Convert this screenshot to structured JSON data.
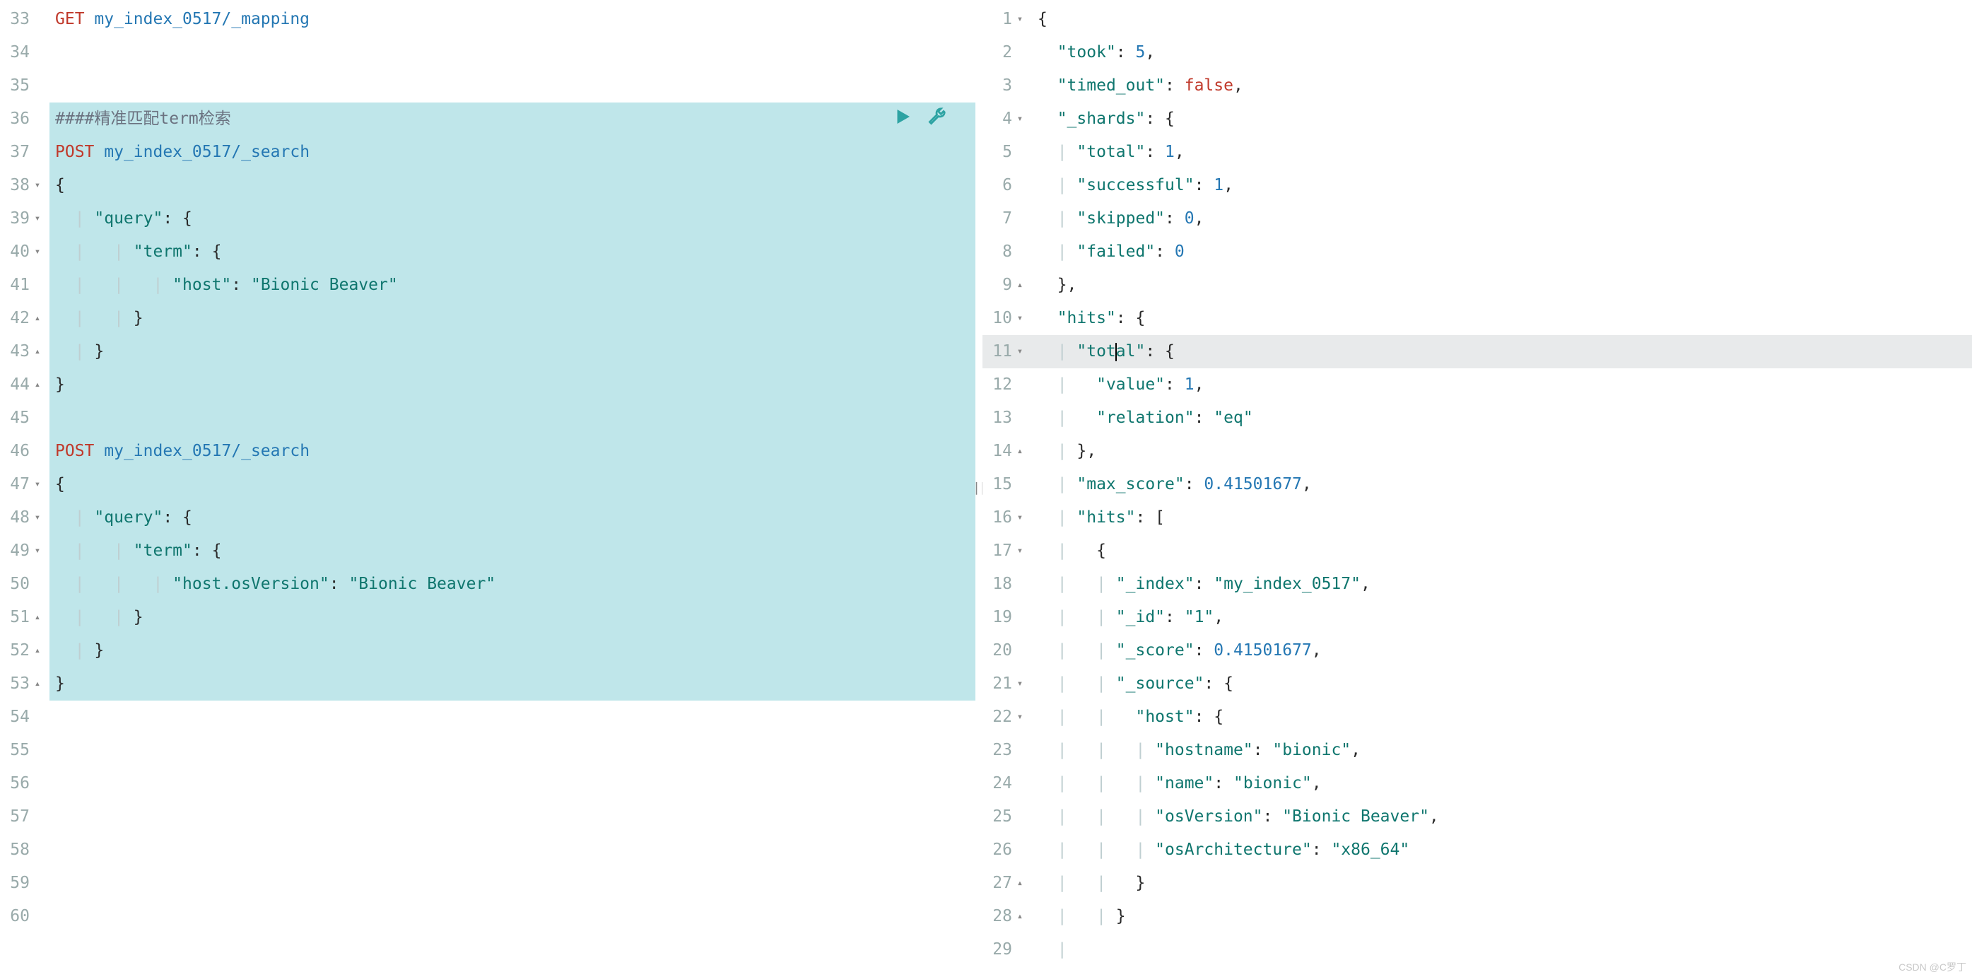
{
  "left": {
    "startLine": 33,
    "lines": [
      {
        "n": 33,
        "fold": "",
        "sel": false,
        "segs": [
          {
            "cls": "tok-method-get",
            "t": "GET "
          },
          {
            "cls": "tok-path",
            "t": "my_index_0517/_mapping"
          }
        ]
      },
      {
        "n": 34,
        "fold": "",
        "sel": false,
        "segs": []
      },
      {
        "n": 35,
        "fold": "",
        "sel": false,
        "segs": []
      },
      {
        "n": 36,
        "fold": "",
        "sel": true,
        "runIcons": true,
        "segs": [
          {
            "cls": "tok-comment",
            "t": "####精准匹配term检索"
          }
        ]
      },
      {
        "n": 37,
        "fold": "",
        "sel": true,
        "segs": [
          {
            "cls": "tok-method-post",
            "t": "POST "
          },
          {
            "cls": "tok-path",
            "t": "my_index_0517/_search"
          }
        ]
      },
      {
        "n": 38,
        "fold": "▾",
        "sel": true,
        "segs": [
          {
            "cls": "tok-punc",
            "t": "{"
          }
        ]
      },
      {
        "n": 39,
        "fold": "▾",
        "sel": true,
        "segs": [
          {
            "cls": "guide",
            "t": "  | "
          },
          {
            "cls": "tok-key",
            "t": "\"query\""
          },
          {
            "cls": "tok-punc",
            "t": ": {"
          }
        ]
      },
      {
        "n": 40,
        "fold": "▾",
        "sel": true,
        "segs": [
          {
            "cls": "guide",
            "t": "  |   | "
          },
          {
            "cls": "tok-key",
            "t": "\"term\""
          },
          {
            "cls": "tok-punc",
            "t": ": {"
          }
        ]
      },
      {
        "n": 41,
        "fold": "",
        "sel": true,
        "segs": [
          {
            "cls": "guide",
            "t": "  |   |   | "
          },
          {
            "cls": "tok-key",
            "t": "\"host\""
          },
          {
            "cls": "tok-punc",
            "t": ": "
          },
          {
            "cls": "tok-str",
            "t": "\"Bionic Beaver\""
          }
        ]
      },
      {
        "n": 42,
        "fold": "▴",
        "sel": true,
        "segs": [
          {
            "cls": "guide",
            "t": "  |   | "
          },
          {
            "cls": "tok-punc",
            "t": "}"
          }
        ]
      },
      {
        "n": 43,
        "fold": "▴",
        "sel": true,
        "segs": [
          {
            "cls": "guide",
            "t": "  | "
          },
          {
            "cls": "tok-punc",
            "t": "}"
          }
        ]
      },
      {
        "n": 44,
        "fold": "▴",
        "sel": true,
        "segs": [
          {
            "cls": "tok-punc",
            "t": "}"
          }
        ]
      },
      {
        "n": 45,
        "fold": "",
        "sel": true,
        "segs": []
      },
      {
        "n": 46,
        "fold": "",
        "sel": true,
        "segs": [
          {
            "cls": "tok-method-post",
            "t": "POST "
          },
          {
            "cls": "tok-path",
            "t": "my_index_0517/_search"
          }
        ]
      },
      {
        "n": 47,
        "fold": "▾",
        "sel": true,
        "segs": [
          {
            "cls": "tok-punc",
            "t": "{"
          }
        ]
      },
      {
        "n": 48,
        "fold": "▾",
        "sel": true,
        "segs": [
          {
            "cls": "guide",
            "t": "  | "
          },
          {
            "cls": "tok-key",
            "t": "\"query\""
          },
          {
            "cls": "tok-punc",
            "t": ": {"
          }
        ]
      },
      {
        "n": 49,
        "fold": "▾",
        "sel": true,
        "segs": [
          {
            "cls": "guide",
            "t": "  |   | "
          },
          {
            "cls": "tok-key",
            "t": "\"term\""
          },
          {
            "cls": "tok-punc",
            "t": ": {"
          }
        ]
      },
      {
        "n": 50,
        "fold": "",
        "sel": true,
        "segs": [
          {
            "cls": "guide",
            "t": "  |   |   | "
          },
          {
            "cls": "tok-key",
            "t": "\"host.osVersion\""
          },
          {
            "cls": "tok-punc",
            "t": ": "
          },
          {
            "cls": "tok-str",
            "t": "\"Bionic Beaver\""
          }
        ]
      },
      {
        "n": 51,
        "fold": "▴",
        "sel": true,
        "segs": [
          {
            "cls": "guide",
            "t": "  |   | "
          },
          {
            "cls": "tok-punc",
            "t": "}"
          }
        ]
      },
      {
        "n": 52,
        "fold": "▴",
        "sel": true,
        "segs": [
          {
            "cls": "guide",
            "t": "  | "
          },
          {
            "cls": "tok-punc",
            "t": "}"
          }
        ]
      },
      {
        "n": 53,
        "fold": "▴",
        "sel": true,
        "segs": [
          {
            "cls": "tok-punc",
            "t": "}"
          }
        ]
      },
      {
        "n": 54,
        "fold": "",
        "sel": false,
        "segs": []
      },
      {
        "n": 55,
        "fold": "",
        "sel": false,
        "segs": []
      },
      {
        "n": 56,
        "fold": "",
        "sel": false,
        "segs": []
      },
      {
        "n": 57,
        "fold": "",
        "sel": false,
        "segs": []
      },
      {
        "n": 58,
        "fold": "",
        "sel": false,
        "segs": []
      },
      {
        "n": 59,
        "fold": "",
        "sel": false,
        "segs": []
      },
      {
        "n": 60,
        "fold": "",
        "sel": false,
        "segs": []
      }
    ]
  },
  "right": {
    "startLine": 1,
    "activeLine": 11,
    "cursorLine": 11,
    "cursorAfterSeg": 2,
    "lines": [
      {
        "n": 1,
        "fold": "▾",
        "segs": [
          {
            "cls": "tok-punc",
            "t": "{"
          }
        ]
      },
      {
        "n": 2,
        "fold": "",
        "segs": [
          {
            "cls": "guide",
            "t": "  "
          },
          {
            "cls": "tok-key",
            "t": "\"took\""
          },
          {
            "cls": "tok-punc",
            "t": ": "
          },
          {
            "cls": "tok-num",
            "t": "5"
          },
          {
            "cls": "tok-punc",
            "t": ","
          }
        ]
      },
      {
        "n": 3,
        "fold": "",
        "segs": [
          {
            "cls": "guide",
            "t": "  "
          },
          {
            "cls": "tok-key",
            "t": "\"timed_out\""
          },
          {
            "cls": "tok-punc",
            "t": ": "
          },
          {
            "cls": "tok-bool",
            "t": "false"
          },
          {
            "cls": "tok-punc",
            "t": ","
          }
        ]
      },
      {
        "n": 4,
        "fold": "▾",
        "segs": [
          {
            "cls": "guide",
            "t": "  "
          },
          {
            "cls": "tok-key",
            "t": "\"_shards\""
          },
          {
            "cls": "tok-punc",
            "t": ": {"
          }
        ]
      },
      {
        "n": 5,
        "fold": "",
        "segs": [
          {
            "cls": "guide",
            "t": "  | "
          },
          {
            "cls": "tok-key",
            "t": "\"total\""
          },
          {
            "cls": "tok-punc",
            "t": ": "
          },
          {
            "cls": "tok-num",
            "t": "1"
          },
          {
            "cls": "tok-punc",
            "t": ","
          }
        ]
      },
      {
        "n": 6,
        "fold": "",
        "segs": [
          {
            "cls": "guide",
            "t": "  | "
          },
          {
            "cls": "tok-key",
            "t": "\"successful\""
          },
          {
            "cls": "tok-punc",
            "t": ": "
          },
          {
            "cls": "tok-num",
            "t": "1"
          },
          {
            "cls": "tok-punc",
            "t": ","
          }
        ]
      },
      {
        "n": 7,
        "fold": "",
        "segs": [
          {
            "cls": "guide",
            "t": "  | "
          },
          {
            "cls": "tok-key",
            "t": "\"skipped\""
          },
          {
            "cls": "tok-punc",
            "t": ": "
          },
          {
            "cls": "tok-num",
            "t": "0"
          },
          {
            "cls": "tok-punc",
            "t": ","
          }
        ]
      },
      {
        "n": 8,
        "fold": "",
        "segs": [
          {
            "cls": "guide",
            "t": "  | "
          },
          {
            "cls": "tok-key",
            "t": "\"failed\""
          },
          {
            "cls": "tok-punc",
            "t": ": "
          },
          {
            "cls": "tok-num",
            "t": "0"
          }
        ]
      },
      {
        "n": 9,
        "fold": "▴",
        "segs": [
          {
            "cls": "guide",
            "t": "  "
          },
          {
            "cls": "tok-punc",
            "t": "},"
          }
        ]
      },
      {
        "n": 10,
        "fold": "▾",
        "segs": [
          {
            "cls": "guide",
            "t": "  "
          },
          {
            "cls": "tok-key",
            "t": "\"hits\""
          },
          {
            "cls": "tok-punc",
            "t": ": {"
          }
        ]
      },
      {
        "n": 11,
        "fold": "▾",
        "segs": [
          {
            "cls": "guide",
            "t": "  | "
          },
          {
            "cls": "tok-key",
            "t": "\"tot"
          },
          {
            "cls": "tok-key",
            "t": "al\""
          },
          {
            "cls": "tok-punc",
            "t": ": {"
          }
        ]
      },
      {
        "n": 12,
        "fold": "",
        "segs": [
          {
            "cls": "guide",
            "t": "  |   "
          },
          {
            "cls": "tok-key",
            "t": "\"value\""
          },
          {
            "cls": "tok-punc",
            "t": ": "
          },
          {
            "cls": "tok-num",
            "t": "1"
          },
          {
            "cls": "tok-punc",
            "t": ","
          }
        ]
      },
      {
        "n": 13,
        "fold": "",
        "segs": [
          {
            "cls": "guide",
            "t": "  |   "
          },
          {
            "cls": "tok-key",
            "t": "\"relation\""
          },
          {
            "cls": "tok-punc",
            "t": ": "
          },
          {
            "cls": "tok-str",
            "t": "\"eq\""
          }
        ]
      },
      {
        "n": 14,
        "fold": "▴",
        "segs": [
          {
            "cls": "guide",
            "t": "  | "
          },
          {
            "cls": "tok-punc",
            "t": "},"
          }
        ]
      },
      {
        "n": 15,
        "fold": "",
        "segs": [
          {
            "cls": "guide",
            "t": "  | "
          },
          {
            "cls": "tok-key",
            "t": "\"max_score\""
          },
          {
            "cls": "tok-punc",
            "t": ": "
          },
          {
            "cls": "tok-num",
            "t": "0.41501677"
          },
          {
            "cls": "tok-punc",
            "t": ","
          }
        ]
      },
      {
        "n": 16,
        "fold": "▾",
        "segs": [
          {
            "cls": "guide",
            "t": "  | "
          },
          {
            "cls": "tok-key",
            "t": "\"hits\""
          },
          {
            "cls": "tok-punc",
            "t": ": ["
          }
        ]
      },
      {
        "n": 17,
        "fold": "▾",
        "segs": [
          {
            "cls": "guide",
            "t": "  |   "
          },
          {
            "cls": "tok-punc",
            "t": "{"
          }
        ]
      },
      {
        "n": 18,
        "fold": "",
        "segs": [
          {
            "cls": "guide",
            "t": "  |   | "
          },
          {
            "cls": "tok-key",
            "t": "\"_index\""
          },
          {
            "cls": "tok-punc",
            "t": ": "
          },
          {
            "cls": "tok-str",
            "t": "\"my_index_0517\""
          },
          {
            "cls": "tok-punc",
            "t": ","
          }
        ]
      },
      {
        "n": 19,
        "fold": "",
        "segs": [
          {
            "cls": "guide",
            "t": "  |   | "
          },
          {
            "cls": "tok-key",
            "t": "\"_id\""
          },
          {
            "cls": "tok-punc",
            "t": ": "
          },
          {
            "cls": "tok-str",
            "t": "\"1\""
          },
          {
            "cls": "tok-punc",
            "t": ","
          }
        ]
      },
      {
        "n": 20,
        "fold": "",
        "segs": [
          {
            "cls": "guide",
            "t": "  |   | "
          },
          {
            "cls": "tok-key",
            "t": "\"_score\""
          },
          {
            "cls": "tok-punc",
            "t": ": "
          },
          {
            "cls": "tok-num",
            "t": "0.41501677"
          },
          {
            "cls": "tok-punc",
            "t": ","
          }
        ]
      },
      {
        "n": 21,
        "fold": "▾",
        "segs": [
          {
            "cls": "guide",
            "t": "  |   | "
          },
          {
            "cls": "tok-key",
            "t": "\"_source\""
          },
          {
            "cls": "tok-punc",
            "t": ": {"
          }
        ]
      },
      {
        "n": 22,
        "fold": "▾",
        "segs": [
          {
            "cls": "guide",
            "t": "  |   |   "
          },
          {
            "cls": "tok-key",
            "t": "\"host\""
          },
          {
            "cls": "tok-punc",
            "t": ": {"
          }
        ]
      },
      {
        "n": 23,
        "fold": "",
        "segs": [
          {
            "cls": "guide",
            "t": "  |   |   | "
          },
          {
            "cls": "tok-key",
            "t": "\"hostname\""
          },
          {
            "cls": "tok-punc",
            "t": ": "
          },
          {
            "cls": "tok-str",
            "t": "\"bionic\""
          },
          {
            "cls": "tok-punc",
            "t": ","
          }
        ]
      },
      {
        "n": 24,
        "fold": "",
        "segs": [
          {
            "cls": "guide",
            "t": "  |   |   | "
          },
          {
            "cls": "tok-key",
            "t": "\"name\""
          },
          {
            "cls": "tok-punc",
            "t": ": "
          },
          {
            "cls": "tok-str",
            "t": "\"bionic\""
          },
          {
            "cls": "tok-punc",
            "t": ","
          }
        ]
      },
      {
        "n": 25,
        "fold": "",
        "segs": [
          {
            "cls": "guide",
            "t": "  |   |   | "
          },
          {
            "cls": "tok-key",
            "t": "\"osVersion\""
          },
          {
            "cls": "tok-punc",
            "t": ": "
          },
          {
            "cls": "tok-str",
            "t": "\"Bionic Beaver\""
          },
          {
            "cls": "tok-punc",
            "t": ","
          }
        ]
      },
      {
        "n": 26,
        "fold": "",
        "segs": [
          {
            "cls": "guide",
            "t": "  |   |   | "
          },
          {
            "cls": "tok-key",
            "t": "\"osArchitecture\""
          },
          {
            "cls": "tok-punc",
            "t": ": "
          },
          {
            "cls": "tok-str",
            "t": "\"x86_64\""
          }
        ]
      },
      {
        "n": 27,
        "fold": "▴",
        "segs": [
          {
            "cls": "guide",
            "t": "  |   |   "
          },
          {
            "cls": "tok-punc",
            "t": "}"
          }
        ]
      },
      {
        "n": 28,
        "fold": "▴",
        "segs": [
          {
            "cls": "guide",
            "t": "  |   | "
          },
          {
            "cls": "tok-punc",
            "t": "}"
          }
        ]
      },
      {
        "n": 29,
        "fold": "",
        "segs": [
          {
            "cls": "guide",
            "t": "  |   "
          }
        ]
      }
    ]
  },
  "watermark": "CSDN @C罗丁"
}
